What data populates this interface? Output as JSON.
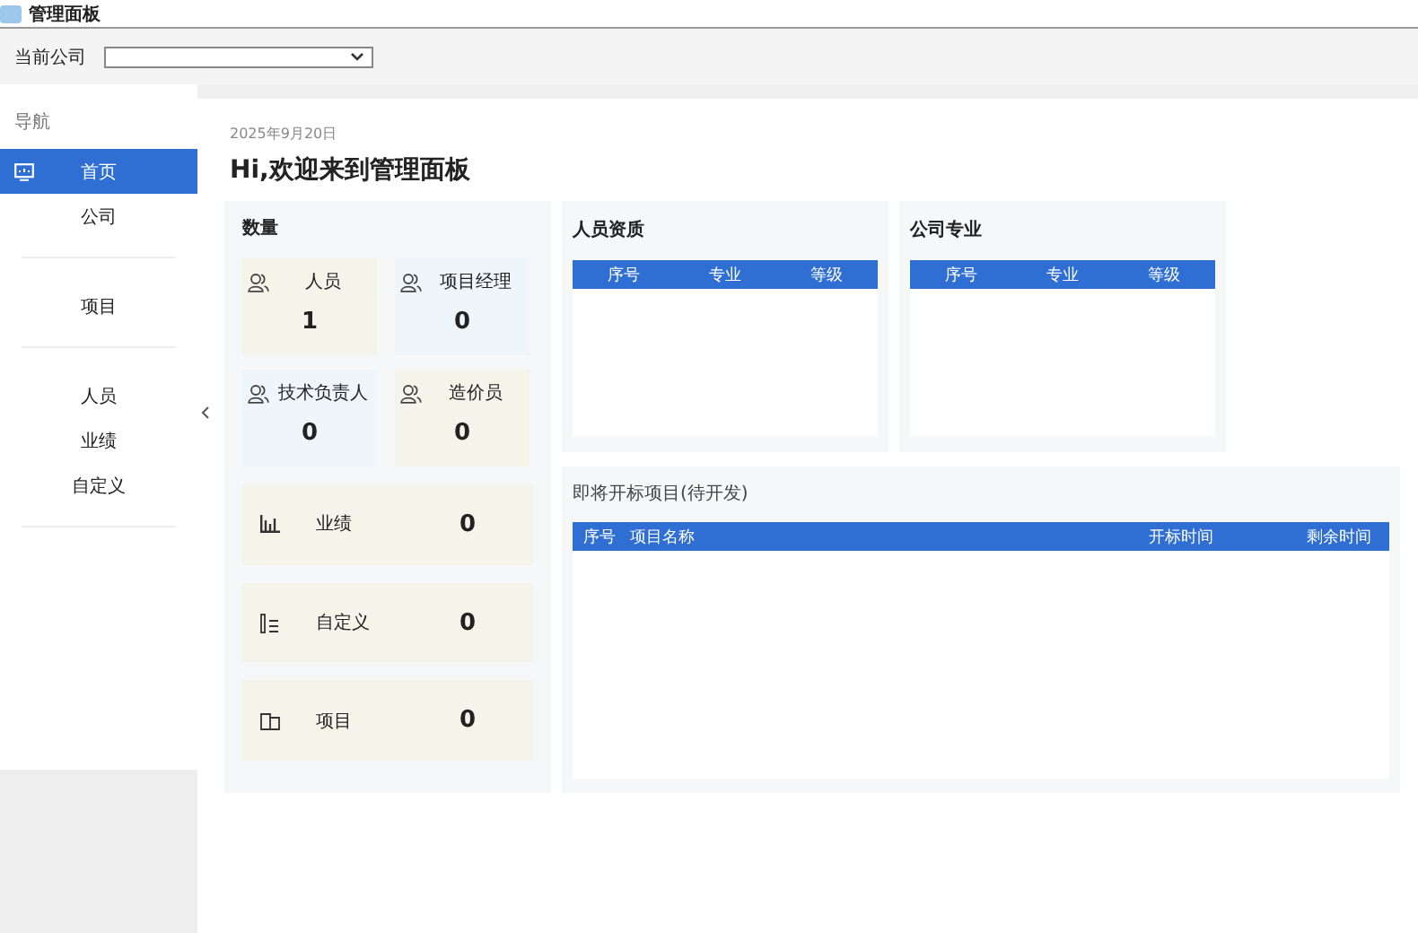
{
  "window": {
    "title": "管理面板"
  },
  "company_picker": {
    "label": "当前公司"
  },
  "sidebar": {
    "heading": "导航",
    "groups": [
      [
        {
          "label": "首页",
          "selected": true
        },
        {
          "label": "公司",
          "selected": false
        }
      ],
      [
        {
          "label": "项目",
          "selected": false
        }
      ],
      [
        {
          "label": "人员",
          "selected": false
        },
        {
          "label": "业绩",
          "selected": false
        },
        {
          "label": "自定义",
          "selected": false
        }
      ]
    ]
  },
  "date": "2025年9月20日",
  "greeting": "Hi,欢迎来到管理面板",
  "counts": {
    "title": "数量",
    "stats": [
      {
        "label": "人员",
        "value": "1",
        "color": "#f4f4ea"
      },
      {
        "label": "项目经理",
        "value": "0",
        "color": "#eef5fb"
      },
      {
        "label": "技术负责人",
        "value": "0",
        "color": "#eef5fb"
      },
      {
        "label": "造价员",
        "value": "0",
        "color": "#f4f4ea"
      }
    ],
    "summaries": [
      {
        "kind": "bar-chart",
        "label": "业绩",
        "value": "0"
      },
      {
        "kind": "list",
        "label": "自定义",
        "value": "0"
      },
      {
        "kind": "book",
        "label": "项目",
        "value": "0"
      }
    ]
  },
  "qualifications": {
    "title": "人员资质",
    "columns": [
      "序号",
      "专业",
      "等级"
    ]
  },
  "company_specialties": {
    "title": "公司专业",
    "columns": [
      "序号",
      "专业",
      "等级"
    ]
  },
  "upcoming_bids": {
    "title": "即将开标项目(待开发)",
    "columns": [
      "序号",
      "项目名称",
      "开标时间",
      "剩余时间"
    ]
  }
}
